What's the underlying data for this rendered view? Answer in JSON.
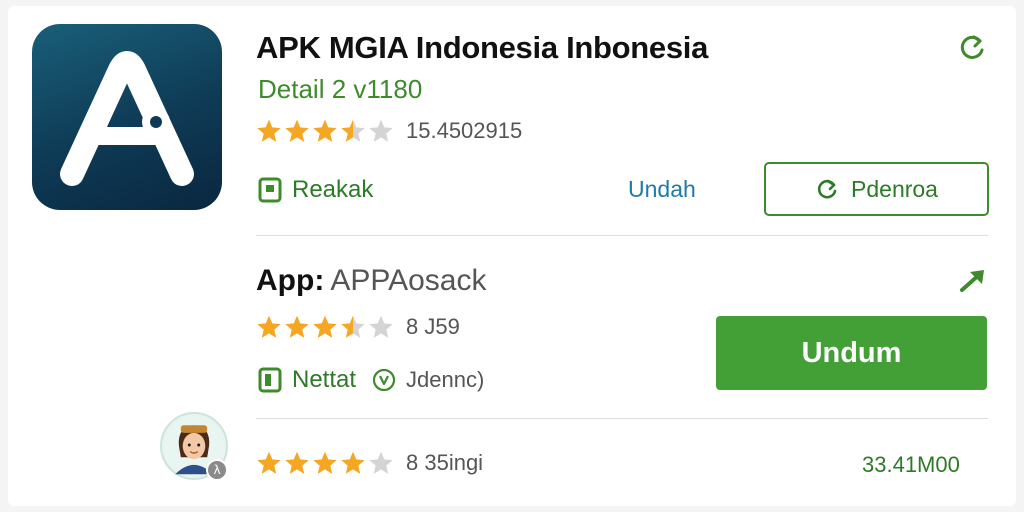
{
  "colors": {
    "accent": "#43a036",
    "star": "#f5a623",
    "link": "#1f7aa8",
    "logo_bg": "#0e3a55"
  },
  "header": {
    "title": "APK MGIA Indonesia Inbonesia",
    "subtitle": "Detail 2 v1180",
    "rating_stars": 3.5,
    "rating_count": "15.4502915",
    "badge_label": "Reakak",
    "link_label": "Undah",
    "secondary_button_label": "Pdenroa",
    "top_icon": "refresh-icon"
  },
  "app_item": {
    "label": "App:",
    "name": "APPAosack",
    "rating_stars": 3.5,
    "rating_count": "8 J59",
    "badge_label": "Nettat",
    "extra_text": "Jdennc)",
    "download_label": "Undum",
    "share_icon": "share-icon"
  },
  "review": {
    "avatar_icon": "user-avatar",
    "rating_stars": 4,
    "rating_text": "8 35ingi",
    "size_text": "33.41M00"
  }
}
